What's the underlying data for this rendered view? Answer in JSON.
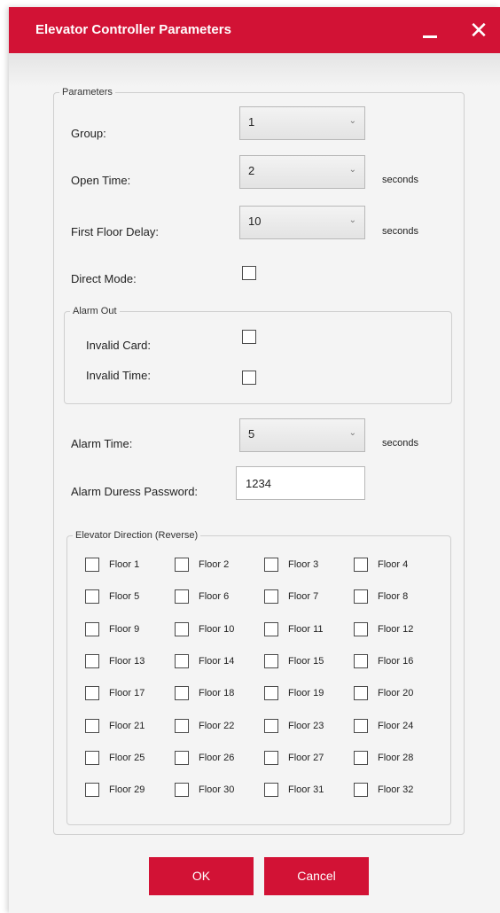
{
  "window": {
    "title": "Elevator Controller Parameters",
    "minimize_icon": "minimize-icon",
    "close_icon": "close-icon",
    "close_glyph": "✕",
    "accent_color": "#d21235"
  },
  "parameters": {
    "legend": "Parameters",
    "group": {
      "label": "Group:",
      "value": "1"
    },
    "open_time": {
      "label": "Open Time:",
      "value": "2",
      "unit": "seconds"
    },
    "first_floor_delay": {
      "label": "First Floor Delay:",
      "value": "10",
      "unit": "seconds"
    },
    "direct_mode": {
      "label": "Direct Mode:",
      "checked": false
    },
    "alarm_out": {
      "legend": "Alarm Out",
      "invalid_card": {
        "label": "Invalid Card:",
        "checked": false
      },
      "invalid_time": {
        "label": "Invalid Time:",
        "checked": false
      }
    },
    "alarm_time": {
      "label": "Alarm Time:",
      "value": "5",
      "unit": "seconds"
    },
    "alarm_duress_password": {
      "label": "Alarm Duress Password:",
      "value": "1234"
    },
    "elevator_direction": {
      "legend": "Elevator Direction (Reverse)",
      "floors": [
        "Floor 1",
        "Floor 2",
        "Floor 3",
        "Floor 4",
        "Floor 5",
        "Floor 6",
        "Floor 7",
        "Floor 8",
        "Floor 9",
        "Floor 10",
        "Floor 11",
        "Floor 12",
        "Floor 13",
        "Floor 14",
        "Floor 15",
        "Floor 16",
        "Floor 17",
        "Floor 18",
        "Floor 19",
        "Floor 20",
        "Floor 21",
        "Floor 22",
        "Floor 23",
        "Floor 24",
        "Floor 25",
        "Floor 26",
        "Floor 27",
        "Floor 28",
        "Floor 29",
        "Floor 30",
        "Floor 31",
        "Floor 32"
      ]
    }
  },
  "buttons": {
    "ok": "OK",
    "cancel": "Cancel"
  }
}
